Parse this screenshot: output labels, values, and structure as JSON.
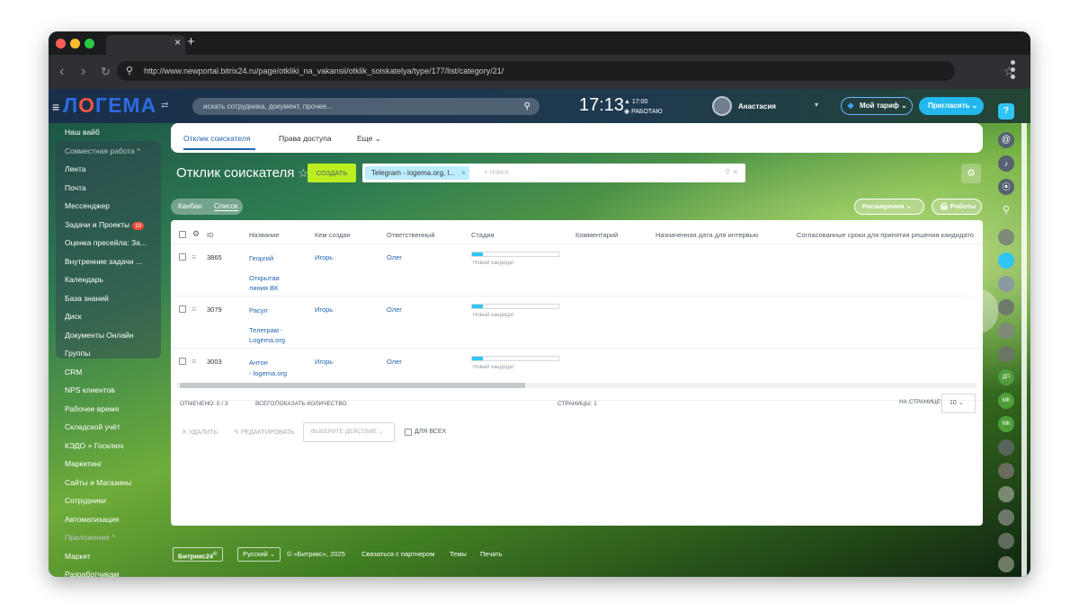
{
  "browser": {
    "url": "http://www.newportal.bitrix24.ru/page/otkliki_na_vakansii/otklik_soiskatelya/type/177/list/category/21/"
  },
  "header": {
    "logo": {
      "p1": "Л",
      "p2": "О",
      "p3": "ГЕМА"
    },
    "search_placeholder": "искать сотрудника, документ, прочее...",
    "time": "17:13",
    "small_time": "17:00",
    "work_status": "РАБОТАЮ",
    "user_name": "Анастасия",
    "tariff": "Мой тариф",
    "invite": "Пригласить"
  },
  "sidebar": {
    "items": [
      {
        "label": "Наш вайб"
      },
      {
        "label": "Совместная работа ^",
        "muted": true
      },
      {
        "label": "Лента"
      },
      {
        "label": "Почта"
      },
      {
        "label": "Мессенджер"
      },
      {
        "label": "Задачи и Проекты",
        "badge": "10"
      },
      {
        "label": "Оценка пресейла: За..."
      },
      {
        "label": "Внутренние задачи ..."
      },
      {
        "label": "Календарь"
      },
      {
        "label": "База знаний"
      },
      {
        "label": "Диск"
      },
      {
        "label": "Документы Онлайн"
      },
      {
        "label": "Группы"
      },
      {
        "label": "CRM"
      },
      {
        "label": "NPS клиентов"
      },
      {
        "label": "Рабочее время"
      },
      {
        "label": "Складской учёт"
      },
      {
        "label": "КЭДО + Госключ"
      },
      {
        "label": "Маркетинг"
      },
      {
        "label": "Сайты и Магазины"
      },
      {
        "label": "Сотрудники"
      },
      {
        "label": "Автоматизация"
      },
      {
        "label": "Приложения ^",
        "muted": true
      },
      {
        "label": "Маркет"
      },
      {
        "label": "Разработчикам"
      }
    ]
  },
  "tabs": [
    "Отклик соискателя",
    "Права доступа",
    "Еще ⌄"
  ],
  "toolbar": {
    "title": "Отклик соискателя",
    "create": "СОЗДАТЬ",
    "filter_tag": "Telegram - logema.org, l...",
    "filter_placeholder": "+ поиск",
    "view_kanban": "Канбан",
    "view_list": "Список",
    "extensions": "Расширения",
    "robots": "Роботы"
  },
  "grid": {
    "columns": [
      "ID",
      "Название",
      "Кем создан",
      "Ответственный",
      "Стадия",
      "Комментарий",
      "Назначенная дата для интервью",
      "Согласованные сроки для принятия решения кандидато"
    ],
    "rows": [
      {
        "id": "3865",
        "name": "Георгий",
        "source": "Открытая\nлиния ВК",
        "created_by": "Игорь",
        "responsible": "Олег",
        "stage": "Новый кандидат",
        "progress": 0.125
      },
      {
        "id": "3079",
        "name": "Расул",
        "source": "Телеграм -\nLogema.org",
        "created_by": "Игорь",
        "responsible": "Олег",
        "stage": "Новый кандидат",
        "progress": 0.125
      },
      {
        "id": "3003",
        "name": "Антон\n- logema.org",
        "source": "",
        "created_by": "Игорь",
        "responsible": "Олег",
        "stage": "Новый кандидат",
        "progress": 0.125
      }
    ],
    "footer": {
      "checked": "ОТМЕЧЕНО: 0 / 3",
      "total_label": "ВСЕГО:",
      "total_link": "ПОКАЗАТЬ КОЛИЧЕСТВО",
      "pages": "СТРАНИЦЫ: 1",
      "per_page_label": "НА СТРАНИЦЕ:",
      "per_page_value": "10"
    },
    "actions": {
      "delete": "УДАЛИТЬ",
      "edit": "РЕДАКТИРОВАТЬ",
      "select_action": "ВЫБЕРИТЕ ДЕЙСТВИЕ",
      "for_all": "ДЛЯ ВСЕХ"
    }
  },
  "footer": {
    "brand": "Битрикс24",
    "language": "Русский",
    "copyright": "© «Битрикс», 2025",
    "partner": "Связаться с партнером",
    "themes": "Темы",
    "print": "Печать"
  },
  "colors": {
    "accent": "#2066b0",
    "create": "#bbed21",
    "invite": "#22b8ee",
    "stage": "#2fc6f6",
    "badge": "#f04d3a"
  }
}
